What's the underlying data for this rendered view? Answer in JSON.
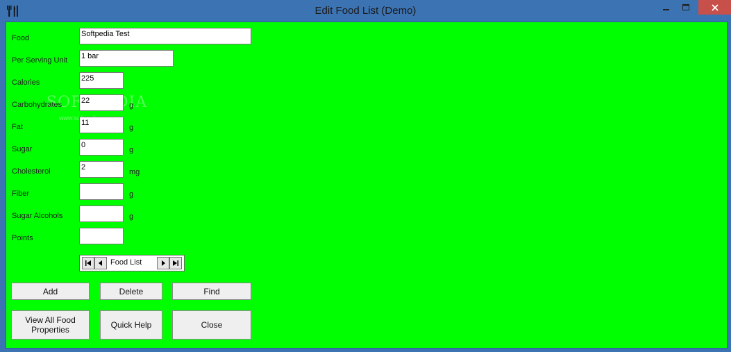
{
  "window": {
    "title": "Edit Food List (Demo)"
  },
  "fields": [
    {
      "label": "Food",
      "value": "Softpedia Test",
      "unit": ""
    },
    {
      "label": "Per Serving Unit",
      "value": "1 bar",
      "unit": ""
    },
    {
      "label": "Calories",
      "value": "225",
      "unit": ""
    },
    {
      "label": "Carbohydrates",
      "value": "22",
      "unit": "g"
    },
    {
      "label": "Fat",
      "value": "11",
      "unit": "g"
    },
    {
      "label": "Sugar",
      "value": "0",
      "unit": "g"
    },
    {
      "label": "Cholesterol",
      "value": "2",
      "unit": "mg"
    },
    {
      "label": "Fiber",
      "value": "",
      "unit": "g"
    },
    {
      "label": "Sugar Alcohols",
      "value": "",
      "unit": "g"
    },
    {
      "label": "Points",
      "value": "",
      "unit": ""
    }
  ],
  "navigator": {
    "label": "Food List"
  },
  "buttons": {
    "add": "Add",
    "delete": "Delete",
    "find": "Find",
    "view_all": "View All Food Properties",
    "quick_help": "Quick Help",
    "close": "Close"
  },
  "watermark": {
    "text": "SOFTPEDIA",
    "url": "www.softpedia.com"
  },
  "colors": {
    "client_bg": "#00ff00",
    "frame": "#3c73b3",
    "close_button": "#c7504b"
  }
}
